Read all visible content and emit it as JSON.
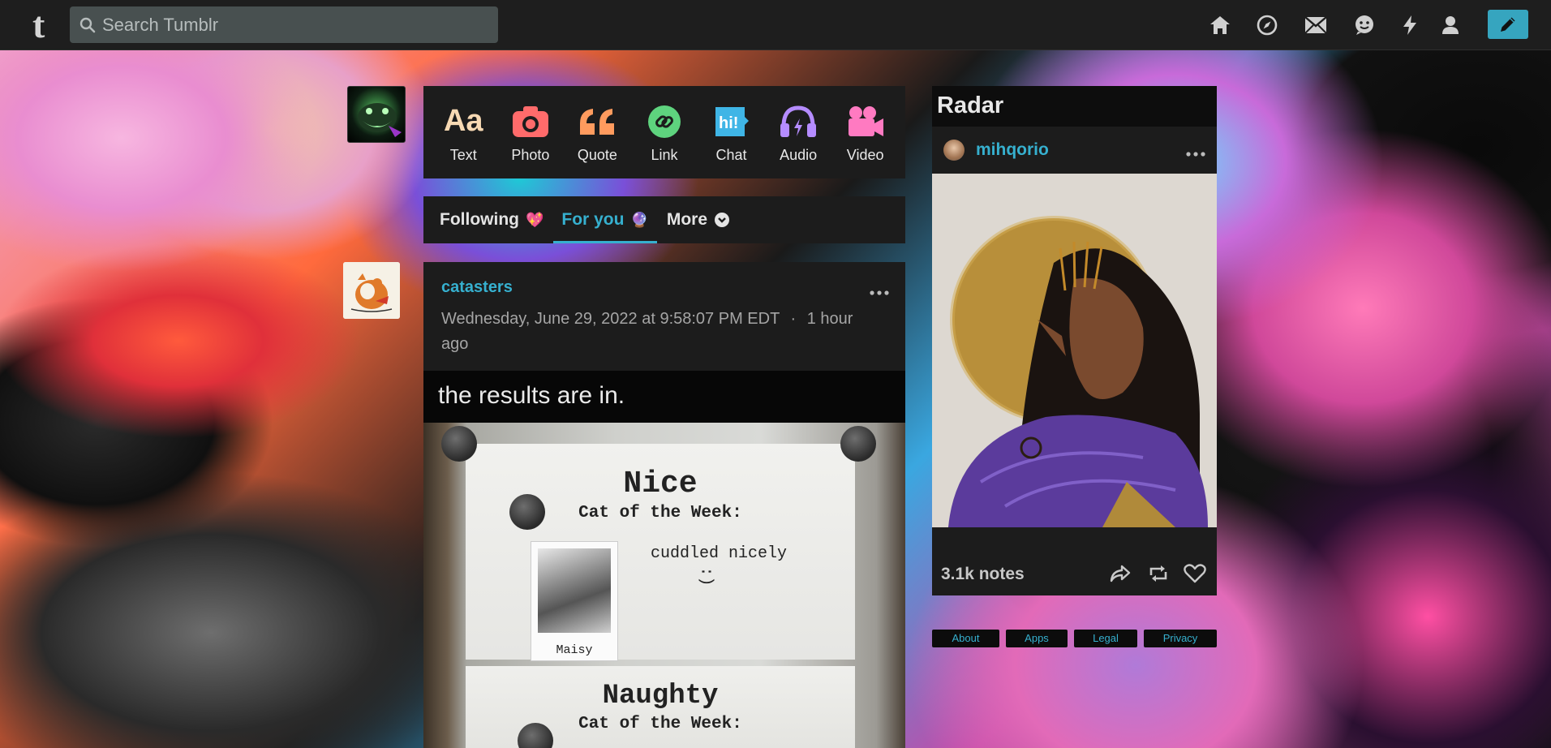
{
  "app": {
    "logo": "t",
    "search": {
      "placeholder": "Search Tumblr"
    },
    "nav_icons": [
      "home-icon",
      "explore-icon",
      "inbox-icon",
      "messages-icon",
      "activity-icon",
      "account-icon"
    ],
    "compose_icon": "pencil-icon",
    "accent_color": "#36b0cf"
  },
  "composer": {
    "types": [
      {
        "label": "Text",
        "icon": "text-icon",
        "color": "#f7d9b3"
      },
      {
        "label": "Photo",
        "icon": "camera-icon",
        "color": "#ff6b6b"
      },
      {
        "label": "Quote",
        "icon": "quote-icon",
        "color": "#ff9b5e"
      },
      {
        "label": "Link",
        "icon": "link-icon",
        "color": "#5ed37e"
      },
      {
        "label": "Chat",
        "icon": "chat-icon",
        "color": "#3fb5e6"
      },
      {
        "label": "Audio",
        "icon": "headphones-icon",
        "color": "#b58cff"
      },
      {
        "label": "Video",
        "icon": "video-icon",
        "color": "#ff7ac1"
      }
    ]
  },
  "tabs": [
    {
      "label": "Following",
      "emoji": "💖",
      "active": false
    },
    {
      "label": "For you",
      "emoji": "🔮",
      "active": true
    },
    {
      "label": "More",
      "emoji": "",
      "active": false
    }
  ],
  "post": {
    "blog": "catasters",
    "timestamp": "Wednesday, June 29, 2022 at 9:58:07 PM EDT",
    "separator": "·",
    "relative_time": "1 hour ago",
    "body": "the results are in.",
    "photo_text": {
      "nice_title": "Nice",
      "nice_subtitle": "Cat of the Week:",
      "nice_reason": "cuddled nicely",
      "smile": ":)",
      "nice_name": "Maisy",
      "naughty_title": "Naughty",
      "naughty_subtitle": "Cat of the Week:"
    }
  },
  "radar": {
    "title": "Radar",
    "blog": "mihqorio",
    "notes": "3.1k notes"
  },
  "footer": {
    "links": [
      "About",
      "Apps",
      "Legal",
      "Privacy"
    ]
  }
}
